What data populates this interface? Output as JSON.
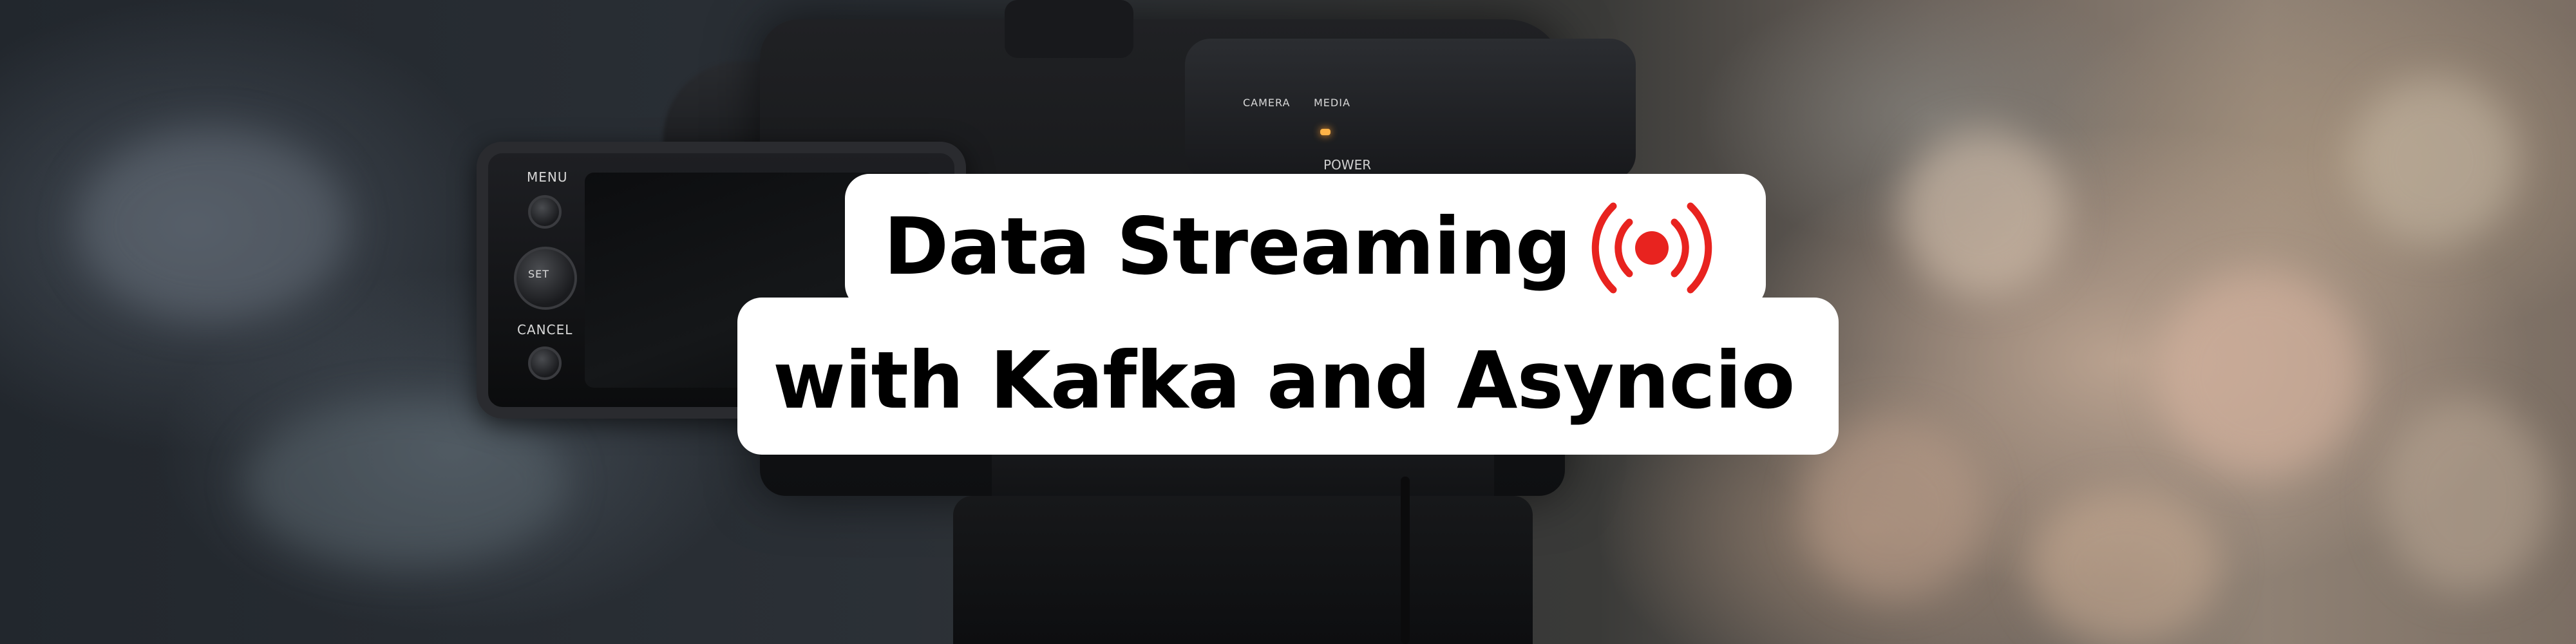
{
  "banner": {
    "title_line1": "Data Streaming",
    "title_line2": "with Kafka and Asyncio",
    "icon": "broadcast-live-icon",
    "icon_color": "#e8231f"
  },
  "camera": {
    "labels": {
      "menu": "MENU",
      "set": "SET",
      "cancel": "CANCEL",
      "power": "POWER",
      "camera": "CAMERA",
      "media": "MEDIA"
    }
  },
  "colors": {
    "pill_background": "#ffffff",
    "text": "#000000"
  }
}
